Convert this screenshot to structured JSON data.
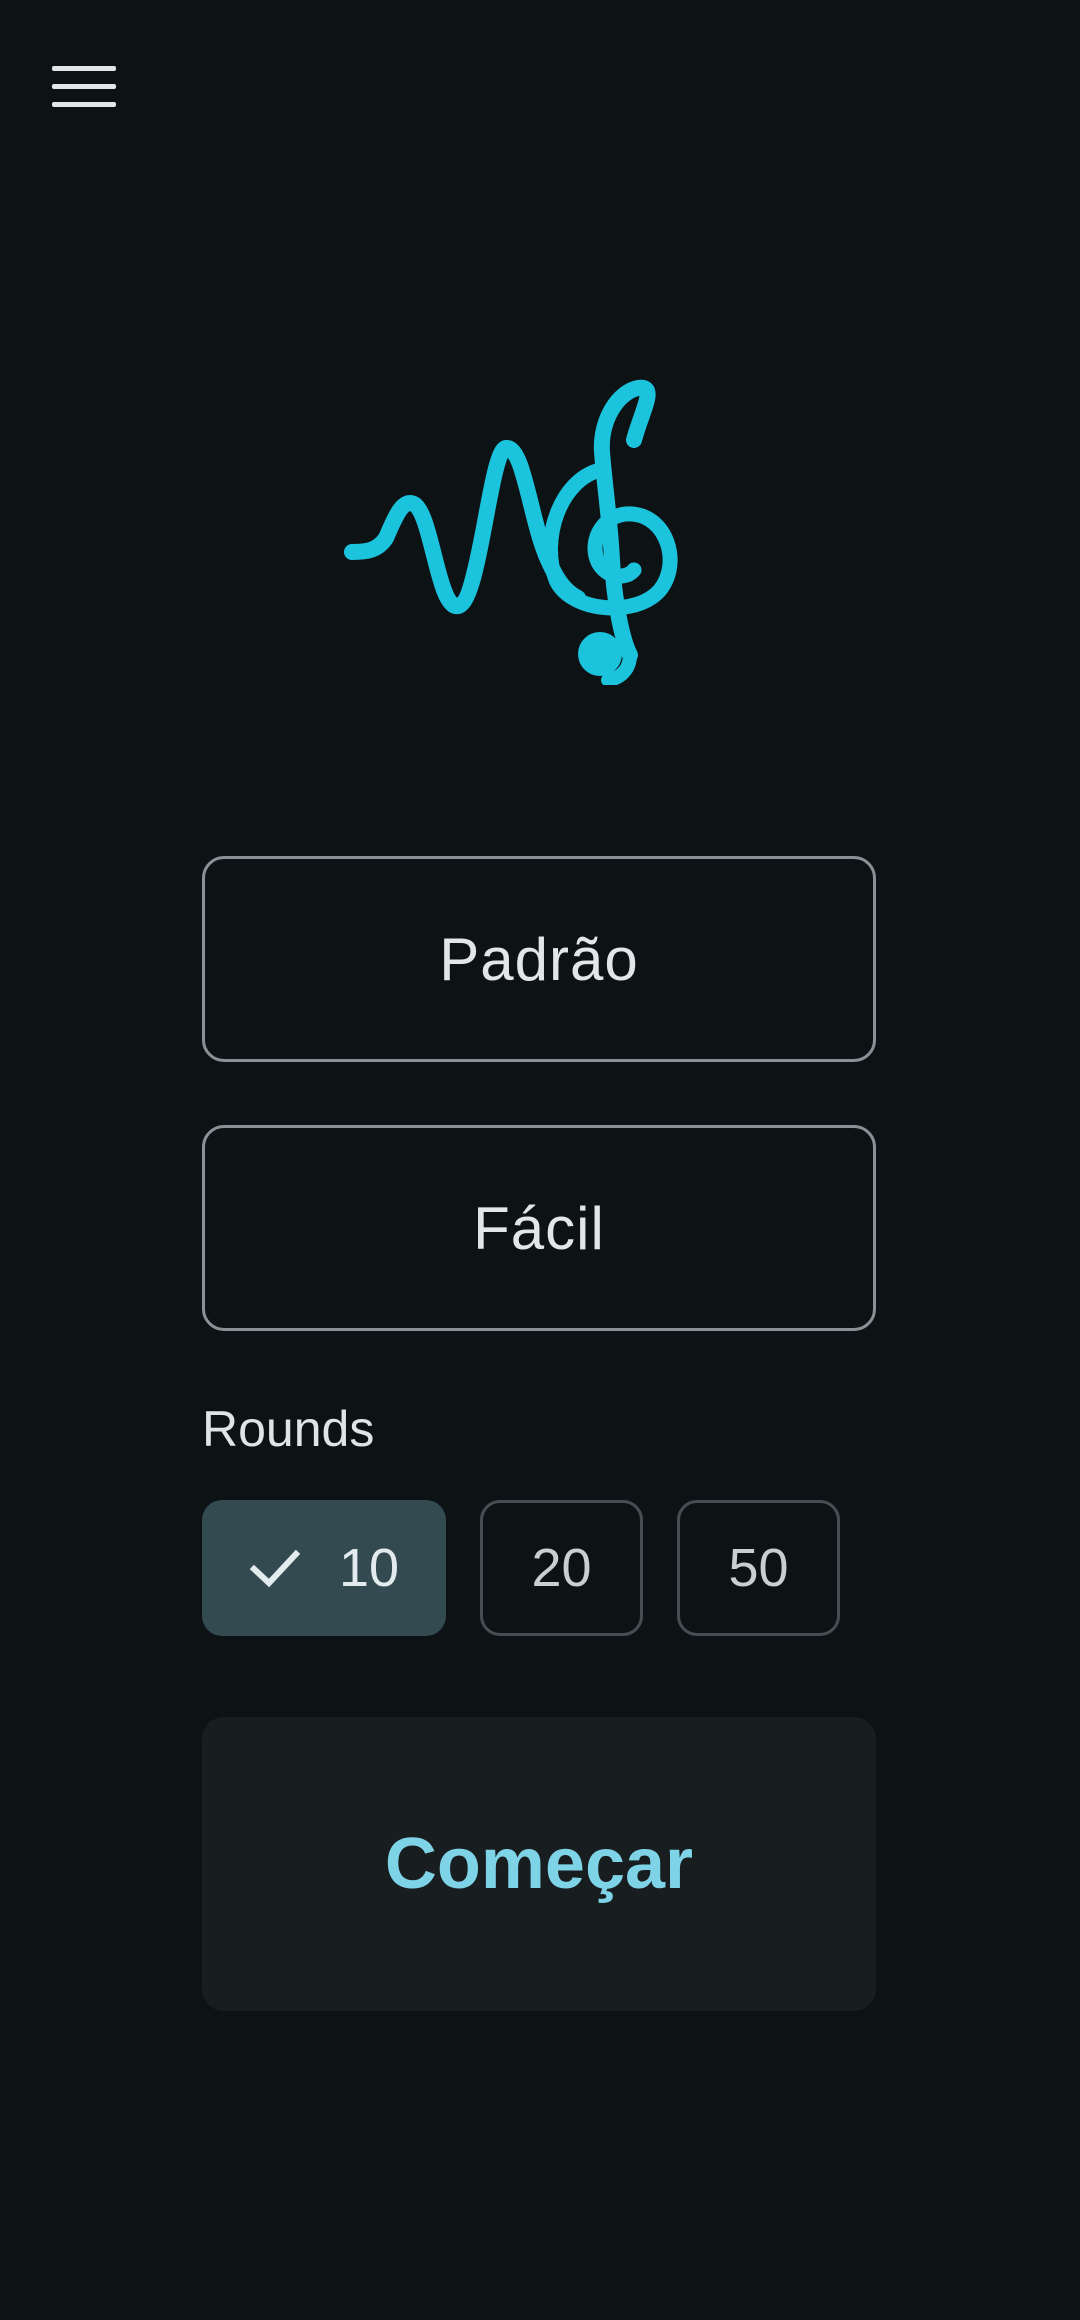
{
  "header": {
    "menu_icon": "hamburger-menu-icon"
  },
  "logo": {
    "icon": "treble-clef-wave-icon",
    "color": "#1cc3dc"
  },
  "mode_select": {
    "value": "Padrão"
  },
  "difficulty_select": {
    "value": "Fácil"
  },
  "rounds": {
    "label": "Rounds",
    "options": [
      "10",
      "20",
      "50"
    ],
    "selected": "10",
    "check_icon": "checkmark-icon"
  },
  "start_button": {
    "label": "Começar"
  },
  "colors": {
    "background": "#0d1215",
    "accent": "#7fd3e6",
    "chip_selected": "#344a51"
  }
}
